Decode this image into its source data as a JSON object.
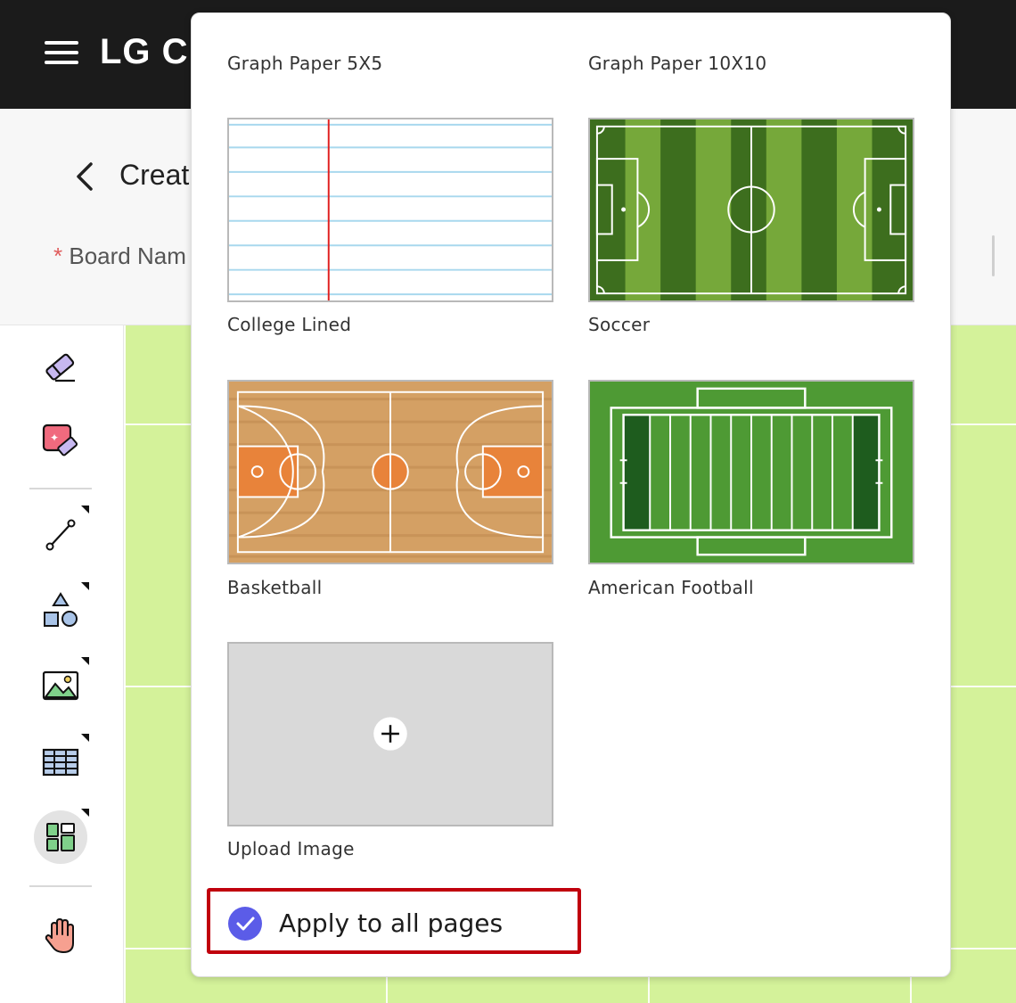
{
  "app": {
    "brand": "LG Cr"
  },
  "header": {
    "title": "Creat",
    "board_name_label": "Board Nam",
    "required_mark": "*"
  },
  "toolbar": {
    "tools": [
      "eraser-icon",
      "magic-eraser-icon",
      "line-icon",
      "shapes-icon",
      "image-icon",
      "table-icon",
      "template-icon",
      "hand-icon"
    ],
    "active": "template-icon"
  },
  "templates": [
    {
      "label": "Graph Paper 5X5"
    },
    {
      "label": "Graph Paper 10X10"
    },
    {
      "label": "College Lined"
    },
    {
      "label": "Soccer"
    },
    {
      "label": "Basketball"
    },
    {
      "label": "American Football"
    },
    {
      "label": "Upload Image"
    }
  ],
  "apply_all": {
    "label": "Apply to all pages",
    "checked": true
  },
  "colors": {
    "accent": "#5b5ce8",
    "highlight_border": "#c0000d",
    "canvas": "#d4f29a"
  }
}
